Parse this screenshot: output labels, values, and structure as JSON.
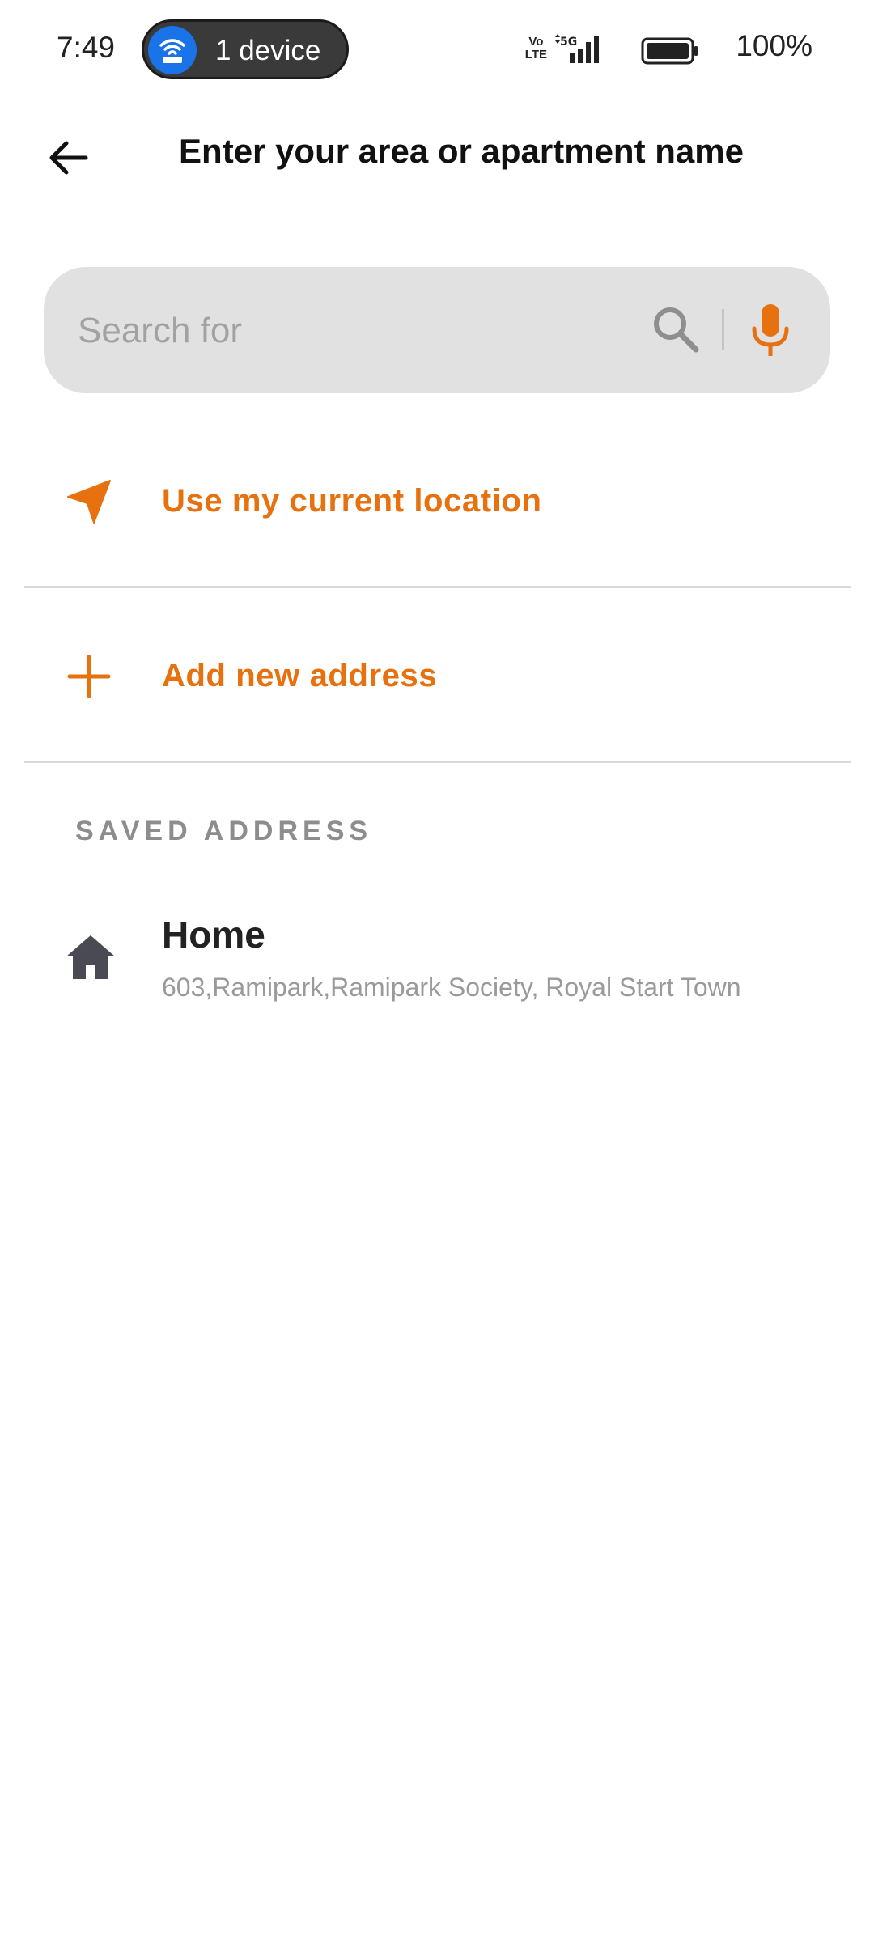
{
  "status_bar": {
    "time": "7:49",
    "hotspot_label": "1 device",
    "network_volte_line1": "Vo",
    "network_volte_line2": "LTE",
    "network_type": "5G",
    "battery_percent": "100%"
  },
  "header": {
    "title": "Enter your area or apartment name"
  },
  "search": {
    "placeholder": "Search for",
    "value": ""
  },
  "options": {
    "current_location": "Use my current location",
    "add_address": "Add new address"
  },
  "saved": {
    "section_title": "SAVED ADDRESS",
    "items": [
      {
        "label": "Home",
        "address": "603,Ramipark,Ramipark Society, Royal Start Town"
      }
    ]
  },
  "colors": {
    "accent": "#e8710f",
    "search_bg": "#e1e1e1",
    "divider": "#d9d9d9",
    "hotspot_blue": "#1a73e8"
  },
  "icons": [
    "back-arrow-icon",
    "wifi-hotspot-icon",
    "signal-icon",
    "battery-icon",
    "search-icon",
    "mic-icon",
    "navigation-arrow-icon",
    "plus-icon",
    "home-icon"
  ]
}
